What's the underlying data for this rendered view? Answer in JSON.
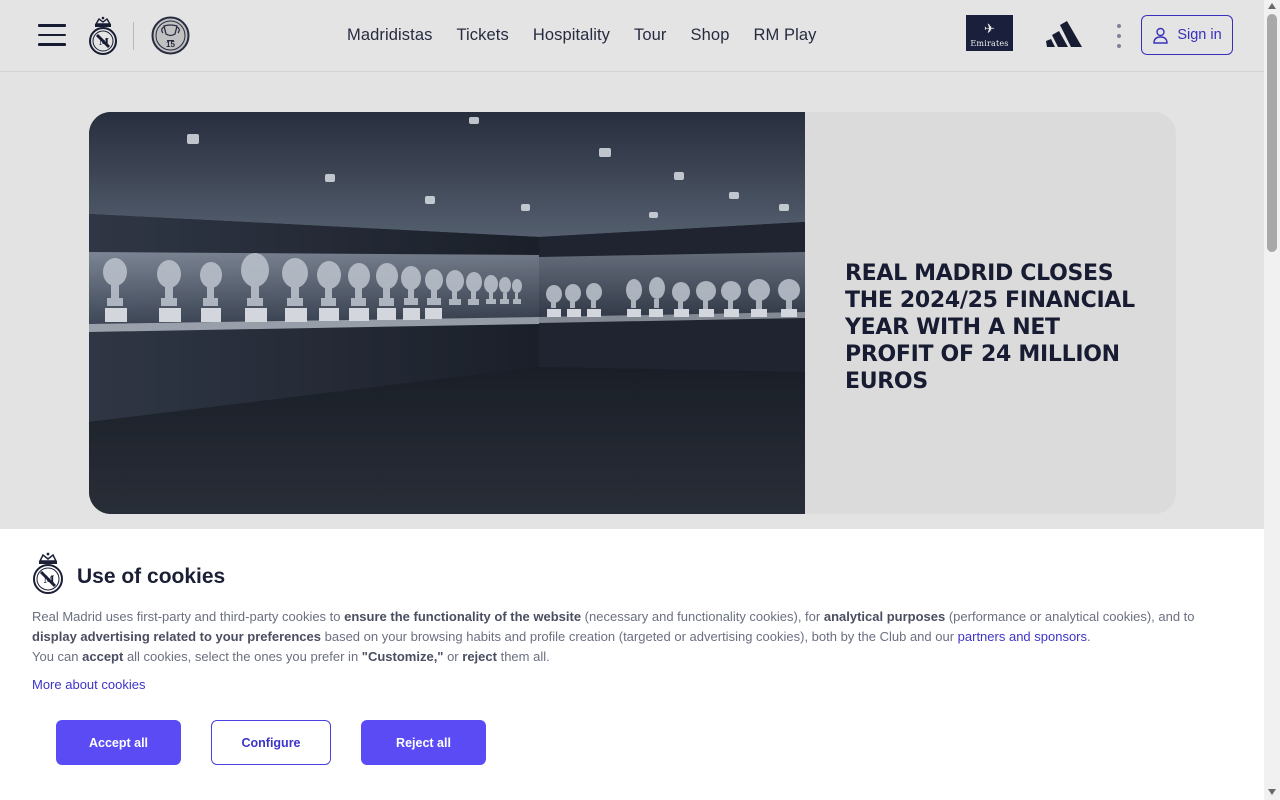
{
  "header": {
    "nav": [
      "Madridistas",
      "Tickets",
      "Hospitality",
      "Tour",
      "Shop",
      "RM Play"
    ],
    "sponsor_emirates": "Emirates",
    "signin_label": "Sign in",
    "ucl_count": "15"
  },
  "hero": {
    "title": "REAL MADRID CLOSES THE 2024/25 FINANCIAL YEAR WITH A NET PROFIT OF 24 MILLION EUROS"
  },
  "cookies": {
    "title": "Use of cookies",
    "p1_a": "Real Madrid uses first-party and third-party cookies to ",
    "p1_b": "ensure the functionality of the website",
    "p1_c": " (necessary and functionality cookies), for ",
    "p1_d": "analytical purposes",
    "p1_e": " (performance or analytical cookies), and to ",
    "p1_f": "display advertising related to your preferences",
    "p1_g": " based on your browsing habits and profile creation (targeted or advertising cookies), both by the Club and our ",
    "p1_link": "partners and sponsors",
    "p1_h": ".",
    "p2_a": "You can ",
    "p2_b": "accept",
    "p2_c": " all cookies, select the ones you prefer in ",
    "p2_d": "\"Customize,\"",
    "p2_e": " or ",
    "p2_f": "reject",
    "p2_g": " them all.",
    "more_link": "More about cookies",
    "accept_label": "Accept all",
    "configure_label": "Configure",
    "reject_label": "Reject all"
  },
  "colors": {
    "accent": "#5a4bf5",
    "link": "#3d34c9",
    "navy": "#1a1f36"
  }
}
